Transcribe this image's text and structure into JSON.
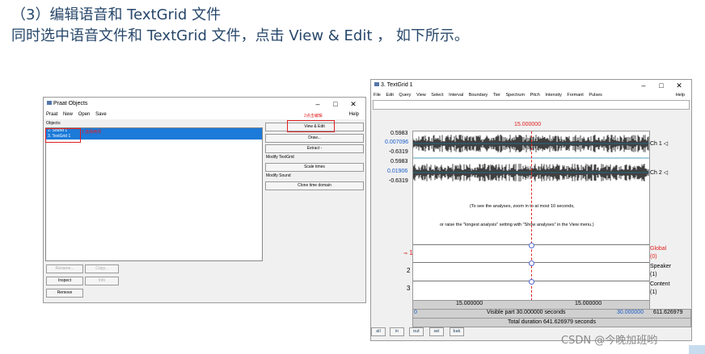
{
  "doc": {
    "line1": "（3）编辑语音和   TextGrid  文件",
    "line2": "同时选中语音文件和   TextGrid  文件，点击 View & Edit ， 如下所示。"
  },
  "objects_window": {
    "title": "Praat Objects",
    "menu": [
      "Praat",
      "New",
      "Open",
      "Save"
    ],
    "help": "Help",
    "objects_label": "Objects:",
    "items": [
      "2. Sound 1",
      "3. TextGrid 1"
    ],
    "annot_select": "1.选择两项",
    "annot_click": "2点击编辑",
    "buttons": {
      "view_edit": "View & Edit",
      "draw": "Draw...",
      "extract": "Extract -",
      "scale_times": "Scale times",
      "clone_time_domain": "Clone time domain",
      "rename": "Rename...",
      "copy": "Copy...",
      "inspect": "Inspect",
      "info": "Info",
      "remove": "Remove"
    },
    "modify_textgrid": "Modify TextGrid",
    "modify_sound": "Modify Sound"
  },
  "editor_window": {
    "title": "3. TextGrid 1",
    "menu": [
      "File",
      "Edit",
      "Query",
      "View",
      "Select",
      "Interval",
      "Boundary",
      "Tier",
      "Spectrum",
      "Pitch",
      "Intensity",
      "Formant",
      "Pulses"
    ],
    "help": "Help",
    "cursor_time": "15.000000",
    "ch1": {
      "max": "0.5983",
      "cur": "0.007096",
      "min": "-0.6319",
      "label": "Ch 1 ◁"
    },
    "ch2": {
      "max": "0.5983",
      "cur": "0.01906",
      "min": "-0.6319",
      "label": "Ch 2 ◁"
    },
    "analysis_msg1": "(To see the analyses, zoom in to at most 10 seconds,",
    "analysis_msg2": "or raise the \"longest analysis\" setting with \"Show analyses\" in the View menu.)",
    "tiers": [
      {
        "num": "1",
        "name": "Global",
        "count": "(0)",
        "prefix": "⇒"
      },
      {
        "num": "2",
        "name": "Speaker",
        "count": "(1)",
        "prefix": ""
      },
      {
        "num": "3",
        "name": "Content",
        "count": "(1)",
        "prefix": ""
      }
    ],
    "bottom": {
      "left_time": "15.000000",
      "right_time": "15.000000",
      "start": "0",
      "visible": "Visible part 30.000000 seconds",
      "end": "30.000000",
      "total_end": "611.626979",
      "total": "Total duration 641.626979 seconds"
    },
    "zoom_buttons": [
      "all",
      "in",
      "out",
      "sel",
      "bak"
    ]
  },
  "watermark": "CSDN @今晚加班哟",
  "colors": {
    "selection": "#1c7ad9",
    "annotation": "#e02020",
    "cursor": "#e02020",
    "blue_text": "#1a5cc8"
  }
}
